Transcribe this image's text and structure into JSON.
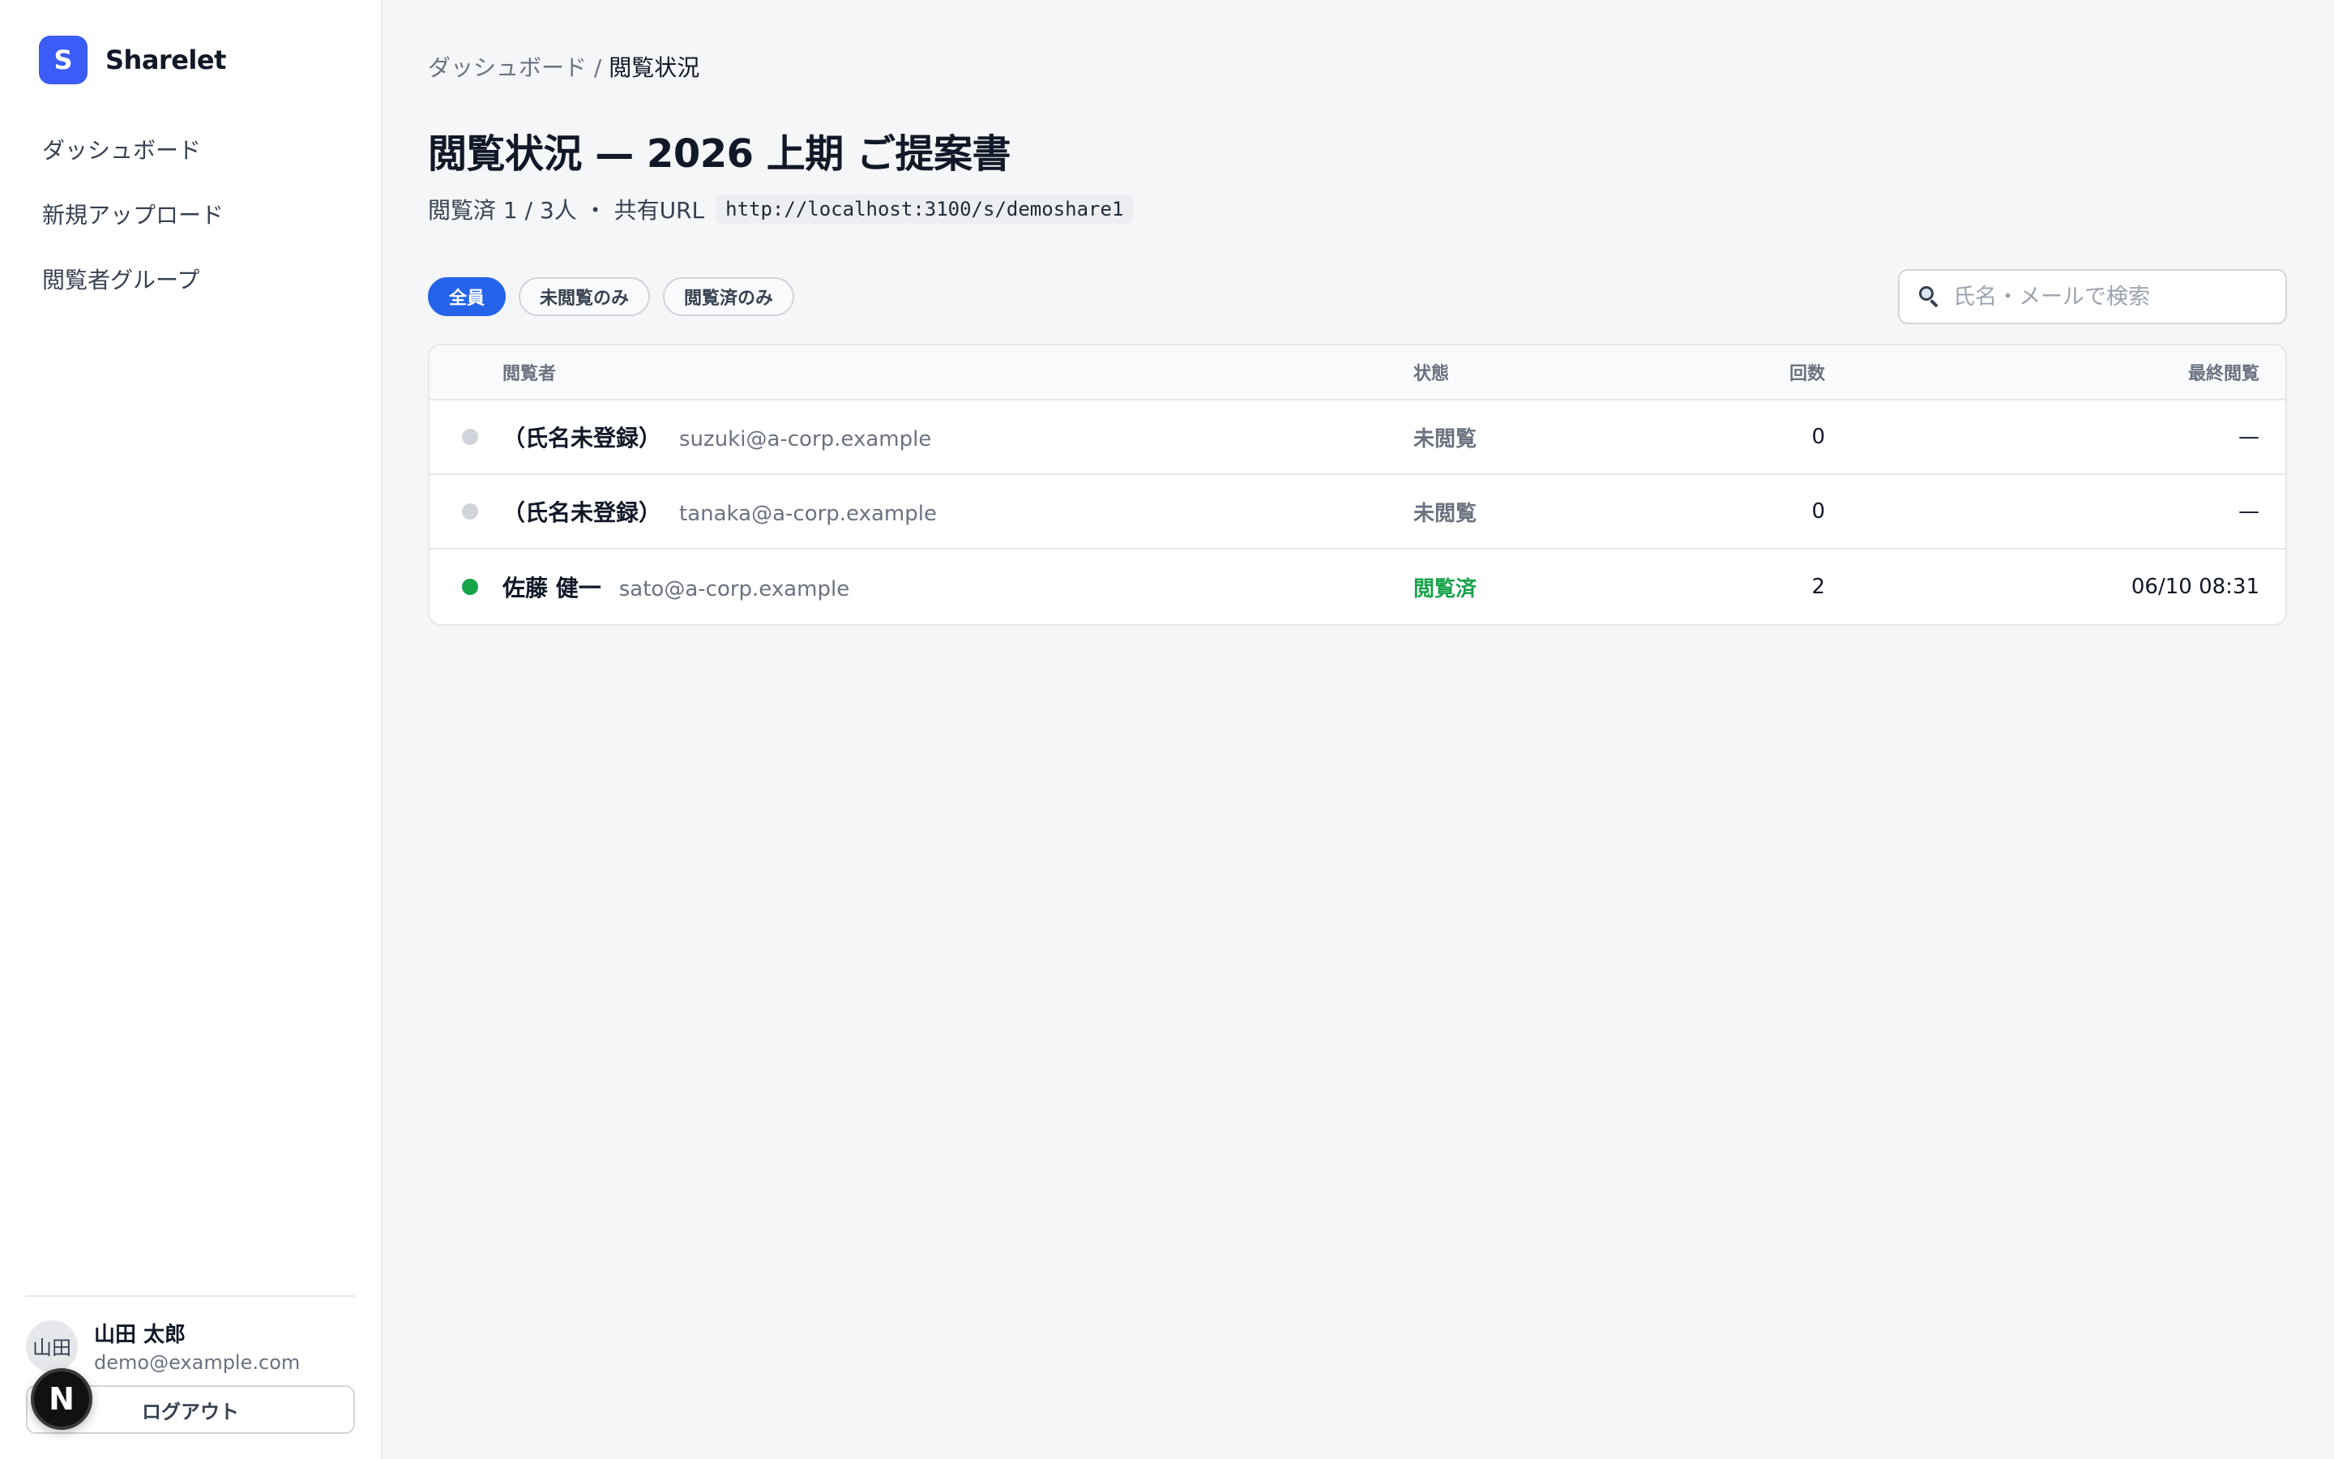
{
  "brand": {
    "logo_letter": "S",
    "name": "Sharelet",
    "accent": "#3b5cf6"
  },
  "nav": {
    "items": [
      {
        "label": "ダッシュボード"
      },
      {
        "label": "新規アップロード"
      },
      {
        "label": "閲覧者グループ"
      }
    ]
  },
  "user": {
    "avatar_text": "山田",
    "name": "山田 太郎",
    "email": "demo@example.com",
    "logout_label": "ログアウト"
  },
  "dev_badge": {
    "letter": "N"
  },
  "breadcrumb": {
    "parent": "ダッシュボード",
    "separator": " / ",
    "current": "閲覧状況"
  },
  "page": {
    "title": "閲覧状況 — 2026 上期 ご提案書",
    "summary": "閲覧済 1 / 3人 ・ 共有URL",
    "share_url": "http://localhost:3100/s/demoshare1"
  },
  "filters": {
    "items": [
      {
        "label": "全員",
        "active": true
      },
      {
        "label": "未閲覧のみ",
        "active": false
      },
      {
        "label": "閲覧済のみ",
        "active": false
      }
    ],
    "active_color": "#2563eb"
  },
  "search": {
    "placeholder": "氏名・メールで検索",
    "value": ""
  },
  "table": {
    "headers": {
      "viewer": "閲覧者",
      "status": "状態",
      "count": "回数",
      "last_view": "最終閲覧"
    },
    "rows": [
      {
        "name": "（氏名未登録）",
        "email": "suzuki@a-corp.example",
        "status": "未閲覧",
        "viewed": false,
        "count": "0",
        "last_view": "—"
      },
      {
        "name": "（氏名未登録）",
        "email": "tanaka@a-corp.example",
        "status": "未閲覧",
        "viewed": false,
        "count": "0",
        "last_view": "—"
      },
      {
        "name": "佐藤 健一",
        "email": "sato@a-corp.example",
        "status": "閲覧済",
        "viewed": true,
        "count": "2",
        "last_view": "06/10 08:31"
      }
    ],
    "status_colors": {
      "viewed": "#16a34a",
      "not_viewed": "#6b7280"
    }
  }
}
